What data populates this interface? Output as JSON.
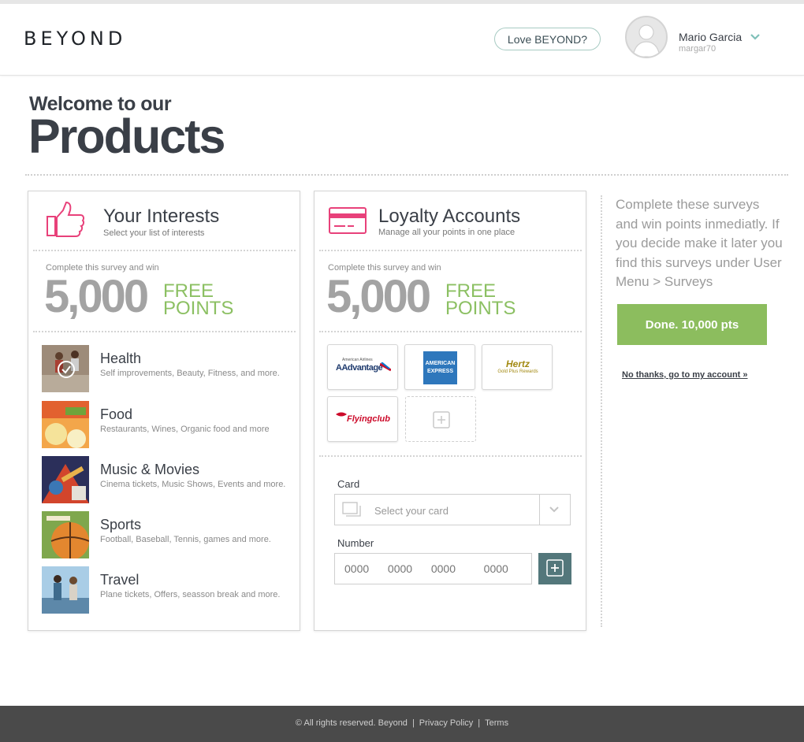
{
  "header": {
    "logo": "BEYOND",
    "love_button": "Love BEYOND?",
    "user_name": "Mario Garcia",
    "user_handle": "margar70"
  },
  "hero": {
    "welcome": "Welcome to our",
    "title": "Products"
  },
  "interests": {
    "title": "Your Interests",
    "subtitle": "Select your list of interests",
    "survey_caption": "Complete this survey and win",
    "points": "5,000",
    "free": "FREE",
    "points_label": "POINTS",
    "items": [
      {
        "title": "Health",
        "desc": "Self improvements, Beauty, Fitness, and more.",
        "selected": true
      },
      {
        "title": "Food",
        "desc": "Restaurants, Wines, Organic food and more",
        "selected": false
      },
      {
        "title": "Music & Movies",
        "desc": "Cinema tickets, Music Shows, Events and more.",
        "selected": false
      },
      {
        "title": "Sports",
        "desc": "Football, Baseball, Tennis, games and more.",
        "selected": false
      },
      {
        "title": "Travel",
        "desc": "Plane tickets, Offers, seasson break and more.",
        "selected": false
      }
    ]
  },
  "loyalty": {
    "title": "Loyalty Accounts",
    "subtitle": "Manage all your points in one place",
    "survey_caption": "Complete this survey and win",
    "points": "5,000",
    "free": "FREE",
    "points_label": "POINTS",
    "programs": [
      {
        "name": "AAdvantage",
        "small": "American Airlines"
      },
      {
        "name": "AMERICAN EXPRESS"
      },
      {
        "name": "Hertz",
        "small": "Gold Plus Rewards"
      },
      {
        "name": "Flyingclub"
      }
    ],
    "card_label": "Card",
    "card_placeholder": "Select your card",
    "number_label": "Number",
    "number_placeholder": "0000  0000  0000   0000"
  },
  "sidebar": {
    "text": "Complete these surveys and win points inmediatly. If you decide make it later you find this surveys under User Menu > Surveys",
    "done_button": "Done. 10,000 pts",
    "no_thanks": "No thanks, go to my account »"
  },
  "footer": {
    "copyright": "© All rights reserved. Beyond",
    "privacy": "Privacy Policy",
    "terms": "Terms"
  },
  "colors": {
    "accent_green": "#8cbd5e",
    "accent_pink": "#e8417a",
    "teal_button": "#53777b",
    "footer_bg": "#4a4a4a"
  }
}
